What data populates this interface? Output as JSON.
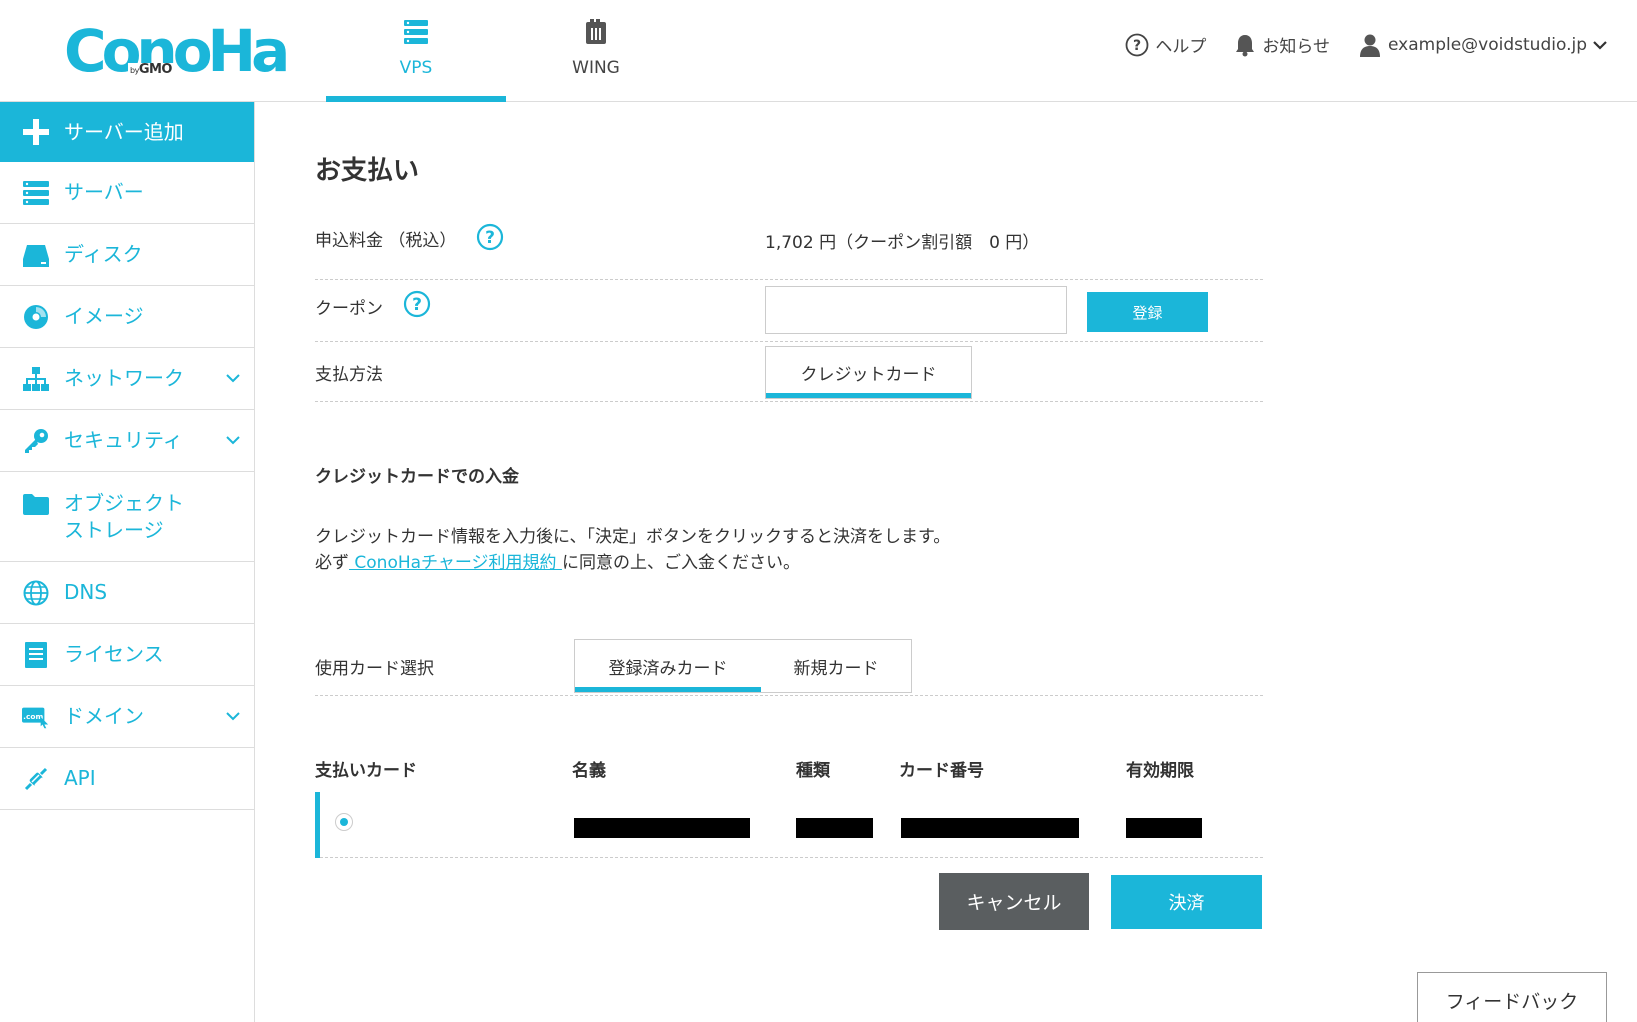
{
  "header": {
    "logo_text": "ConoHa",
    "logo_sub_by": "by",
    "logo_sub": "GMO",
    "tabs": [
      {
        "label": "VPS",
        "icon": "server-icon",
        "active": true
      },
      {
        "label": "WING",
        "icon": "book-icon",
        "active": false
      }
    ],
    "help_label": "ヘルプ",
    "notice_label": "お知らせ",
    "user_email": "example@voidstudio.jp"
  },
  "sidebar": {
    "items": [
      {
        "label": "サーバー追加",
        "icon": "plus-icon"
      },
      {
        "label": "サーバー",
        "icon": "server-icon"
      },
      {
        "label": "ディスク",
        "icon": "disk-icon"
      },
      {
        "label": "イメージ",
        "icon": "disc-icon"
      },
      {
        "label": "ネットワーク",
        "icon": "network-icon"
      },
      {
        "label": "セキュリティ",
        "icon": "key-icon"
      },
      {
        "label_line1": "オブジェクト",
        "label_line2": "ストレージ",
        "icon": "folder-icon"
      },
      {
        "label": "DNS",
        "icon": "globe-icon"
      },
      {
        "label": "ライセンス",
        "icon": "document-icon"
      },
      {
        "label": "ドメイン",
        "icon": "domain-icon",
        "icon_text": ".com"
      },
      {
        "label": "API",
        "icon": "api-icon"
      }
    ]
  },
  "main": {
    "title": "お支払い",
    "fee_label": "申込料金 （税込）",
    "fee_value": "1,702 円（クーポン割引額　0 円）",
    "coupon_label": "クーポン",
    "coupon_value": "",
    "coupon_placeholder": "",
    "register_button": "登録",
    "payment_method_label": "支払方法",
    "payment_method_tab": "クレジットカード",
    "section_title": "クレジットカードでの入金",
    "desc_line1": "クレジットカード情報を入力後に、「決定」ボタンをクリックすると決済をします。",
    "desc_line2_pre": "必ず",
    "desc_link": " ConoHaチャージ利用規約 ",
    "desc_line2_post": "に同意の上、ご入金ください。",
    "card_select_label": "使用カード選択",
    "card_tabs": [
      "登録済みカード",
      "新規カード"
    ],
    "table_headers": [
      "支払いカード",
      "名義",
      "種類",
      "カード番号",
      "有効期限"
    ],
    "cancel_button": "キャンセル",
    "pay_button": "決済"
  },
  "feedback_button": "フィードバック",
  "colors": {
    "accent": "#1bb6d9",
    "cancel": "#5a5e60"
  }
}
